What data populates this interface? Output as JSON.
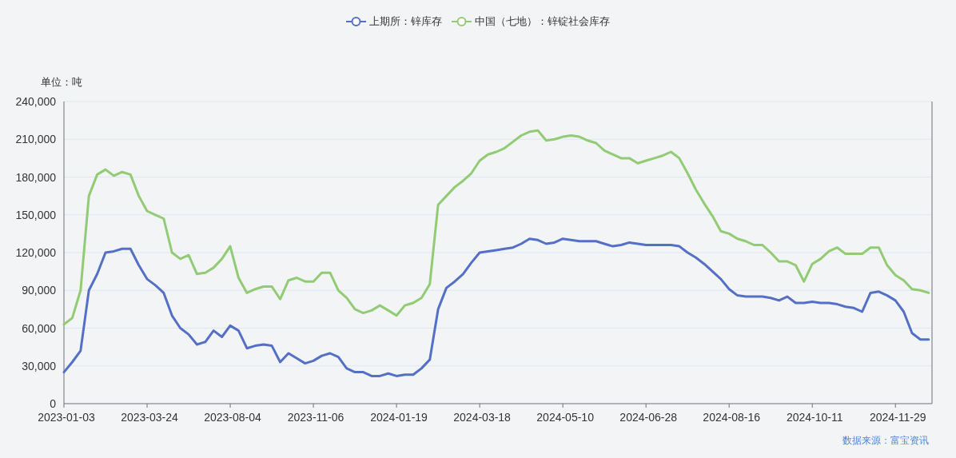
{
  "unit_label": "单位：吨",
  "chart_data": {
    "type": "line",
    "categories": [
      "2023-01-03",
      null,
      null,
      null,
      null,
      null,
      null,
      null,
      null,
      null,
      "2023-03-24",
      null,
      null,
      null,
      null,
      null,
      null,
      null,
      null,
      null,
      "2023-08-04",
      null,
      null,
      null,
      null,
      null,
      null,
      null,
      null,
      null,
      "2023-11-06",
      null,
      null,
      null,
      null,
      null,
      null,
      null,
      null,
      null,
      "2024-01-19",
      null,
      null,
      null,
      null,
      null,
      null,
      null,
      null,
      null,
      "2024-03-18",
      null,
      null,
      null,
      null,
      null,
      null,
      null,
      null,
      null,
      "2024-05-10",
      null,
      null,
      null,
      null,
      null,
      null,
      null,
      null,
      null,
      "2024-06-28",
      null,
      null,
      null,
      null,
      null,
      null,
      null,
      null,
      null,
      "2024-08-16",
      null,
      null,
      null,
      null,
      null,
      null,
      null,
      null,
      null,
      "2024-10-11",
      null,
      null,
      null,
      null,
      null,
      null,
      null,
      null,
      null,
      "2024-11-29",
      null,
      null,
      null,
      null
    ],
    "series": [
      {
        "name": "上期所：锌库存",
        "color": "#5470c6",
        "values": [
          25000,
          33000,
          42000,
          90000,
          103000,
          120000,
          121000,
          123000,
          123000,
          110000,
          99000,
          94000,
          88000,
          70000,
          60000,
          55000,
          47000,
          49000,
          58000,
          53000,
          62000,
          58000,
          44000,
          46000,
          47000,
          46000,
          33000,
          40000,
          36000,
          32000,
          34000,
          38000,
          40000,
          37000,
          28000,
          25000,
          25000,
          22000,
          22000,
          24000,
          22000,
          23000,
          23000,
          28000,
          35000,
          75000,
          92000,
          97000,
          103000,
          112000,
          120000,
          121000,
          122000,
          123000,
          124000,
          127000,
          131000,
          130000,
          127000,
          128000,
          131000,
          130000,
          129000,
          129000,
          129000,
          127000,
          125000,
          126000,
          128000,
          127000,
          126000,
          126000,
          126000,
          126000,
          125000,
          120000,
          116000,
          111000,
          105000,
          99000,
          91000,
          86000,
          85000,
          85000,
          85000,
          84000,
          82000,
          85000,
          80000,
          80000,
          81000,
          80000,
          80000,
          79000,
          77000,
          76000,
          73000,
          88000,
          89000,
          86000,
          82000,
          73000,
          56000,
          51000,
          51000
        ]
      },
      {
        "name": "中国（七地）：锌锭社会库存",
        "color": "#91cc75",
        "values": [
          63000,
          68000,
          90000,
          165000,
          182000,
          186000,
          181000,
          184000,
          182000,
          165000,
          153000,
          150000,
          147000,
          120000,
          115000,
          118000,
          103000,
          104000,
          108000,
          115000,
          125000,
          100000,
          88000,
          91000,
          93000,
          93000,
          83000,
          98000,
          100000,
          97000,
          97000,
          104000,
          104000,
          90000,
          84000,
          75000,
          72000,
          74000,
          78000,
          74000,
          70000,
          78000,
          80000,
          84000,
          95000,
          158000,
          165000,
          172000,
          177000,
          183000,
          193000,
          198000,
          200000,
          203000,
          208000,
          213000,
          216000,
          217000,
          209000,
          210000,
          212000,
          213000,
          212000,
          209000,
          207000,
          201000,
          198000,
          195000,
          195000,
          191000,
          193000,
          195000,
          197000,
          200000,
          195000,
          183000,
          170000,
          159000,
          149000,
          137000,
          135000,
          131000,
          129000,
          126000,
          126000,
          120000,
          113000,
          113000,
          110000,
          97000,
          111000,
          115000,
          121000,
          124000,
          119000,
          119000,
          119000,
          124000,
          124000,
          110000,
          102000,
          98000,
          91000,
          90000,
          88000
        ]
      }
    ],
    "ylim": [
      0,
      240000
    ],
    "yticks": [
      {
        "value": 0,
        "label": "0"
      },
      {
        "value": 30000,
        "label": "30,000"
      },
      {
        "value": 60000,
        "label": "60,000"
      },
      {
        "value": 90000,
        "label": "90,000"
      },
      {
        "value": 120000,
        "label": "120,000"
      },
      {
        "value": 150000,
        "label": "150,000"
      },
      {
        "value": 180000,
        "label": "180,000"
      },
      {
        "value": 210000,
        "label": "210,000"
      },
      {
        "value": 240000,
        "label": "240,000"
      }
    ],
    "grid": true
  },
  "source": "数据来源：富宝资讯"
}
